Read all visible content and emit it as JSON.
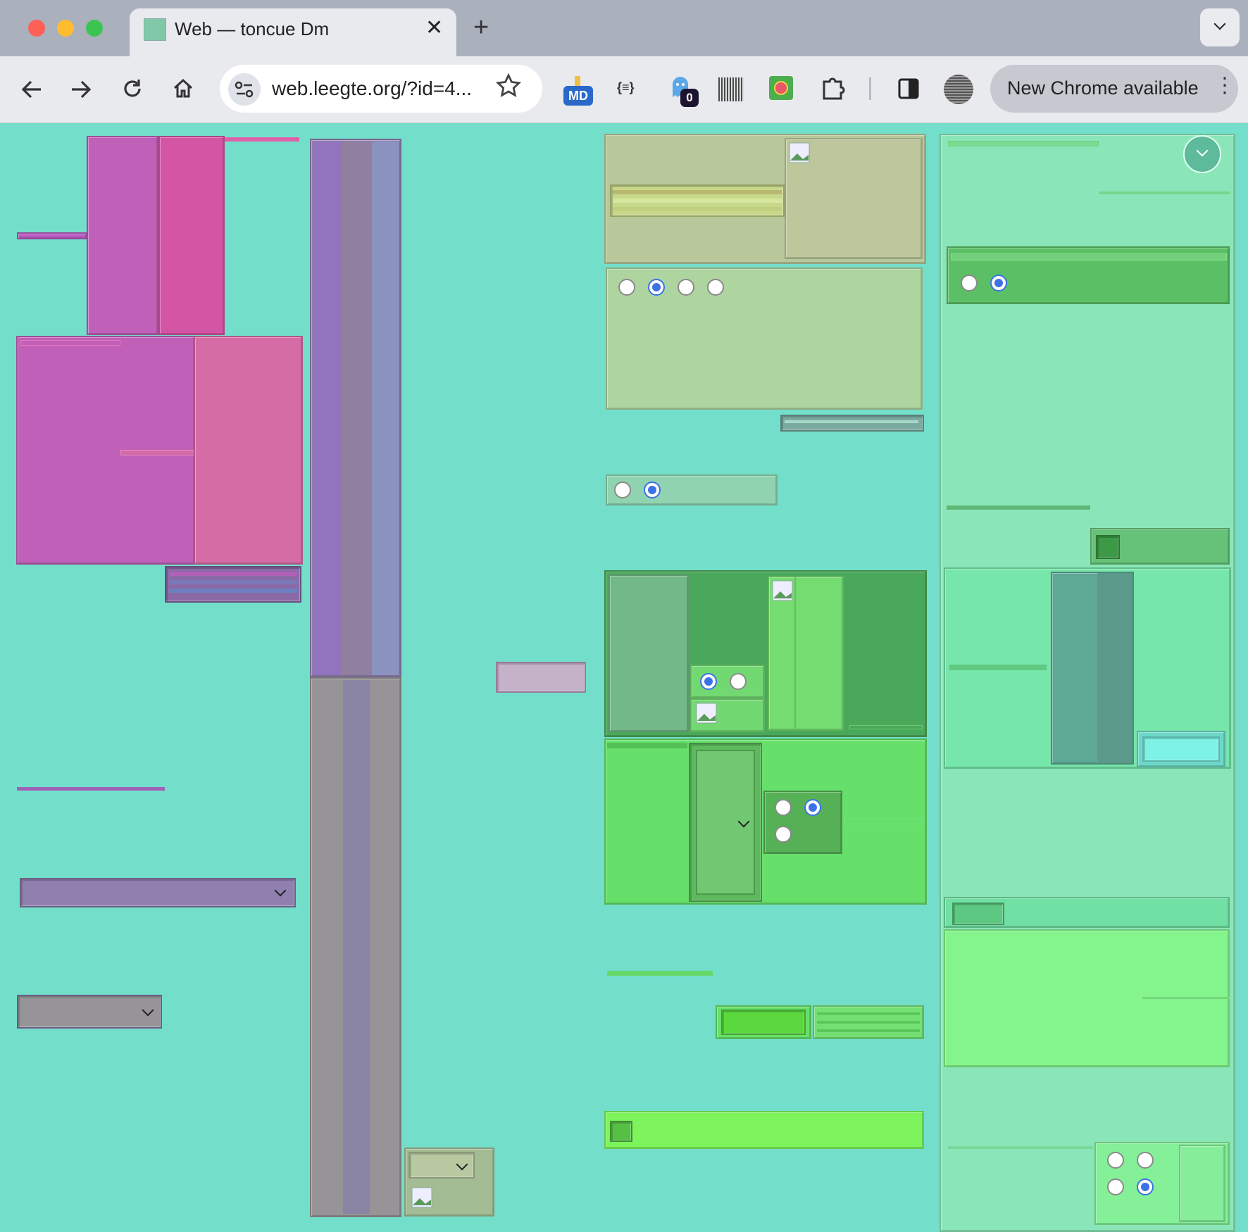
{
  "browser": {
    "tab_title": "Web — toncue Dm",
    "url": "web.leegte.org/?id=4...",
    "update_label": "New Chrome available",
    "new_tab_symbol": "+",
    "close_symbol": "✕",
    "menu_symbol": "⋮",
    "extension_md_label": "MD",
    "extension_json_label": "{≡}",
    "ghost_badge_count": "0"
  },
  "colors": {
    "page_background": "#73dfcb",
    "pink_panel": "#c060b8",
    "violet_column": "#9a7fbe",
    "olive_panel": "#b8c89a",
    "green_panel": "#4aa85a",
    "light_green_panel": "#8ae6b8",
    "radio_selected": "#3b72e8"
  },
  "radio_groups": [
    {
      "name": "olive-group",
      "options": [
        false,
        true,
        false,
        false
      ]
    },
    {
      "name": "pale-group",
      "options": [
        false,
        true
      ]
    },
    {
      "name": "right-top-group",
      "options": [
        false,
        true
      ]
    },
    {
      "name": "green-mid-group",
      "options": [
        true,
        false
      ]
    },
    {
      "name": "green-lower-group",
      "options": [
        false,
        true,
        false
      ]
    },
    {
      "name": "bottom-right-group",
      "options": [
        false,
        false,
        false,
        true
      ]
    }
  ]
}
